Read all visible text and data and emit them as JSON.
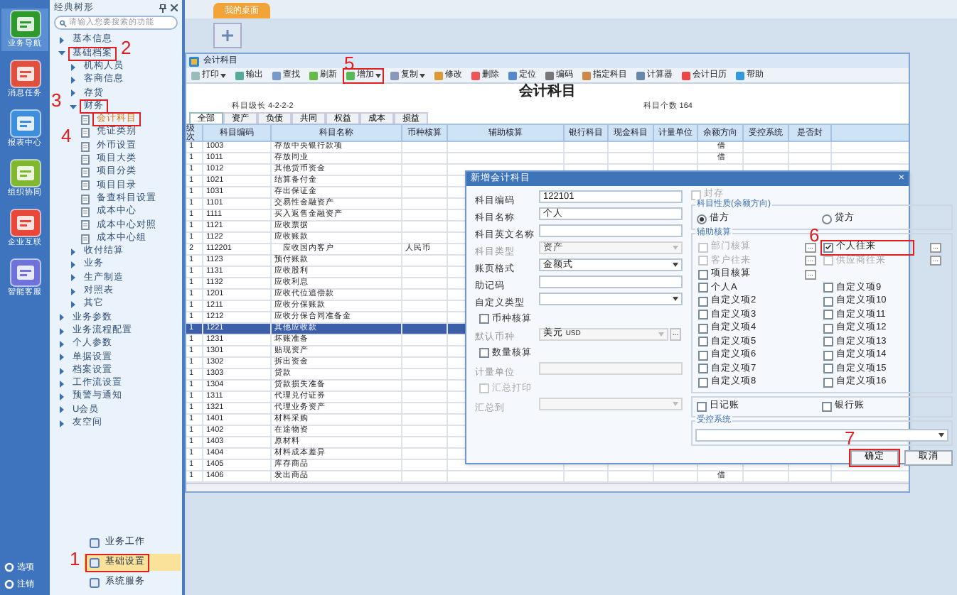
{
  "nav": {
    "items": [
      {
        "label": "业务导航",
        "selected": true
      },
      {
        "label": "消息任务",
        "selected": false
      },
      {
        "label": "报表中心",
        "selected": false
      },
      {
        "label": "组织协同",
        "selected": false
      },
      {
        "label": "企业互联",
        "selected": false
      },
      {
        "label": "智能客服",
        "selected": false
      }
    ],
    "bottom": [
      "选项",
      "注销"
    ]
  },
  "tree_panel": {
    "title": "经典树形",
    "search": {
      "placeholder": "请输入您要搜索的功能"
    },
    "tree": [
      {
        "label": "基本信息",
        "kind": "folder",
        "expanded": false
      },
      {
        "label": "基础档案",
        "kind": "folder",
        "expanded": true,
        "callout": "2",
        "children": [
          {
            "label": "机构人员",
            "kind": "folder",
            "expanded": false
          },
          {
            "label": "客商信息",
            "kind": "folder",
            "expanded": false
          },
          {
            "label": "存货",
            "kind": "folder",
            "expanded": false
          },
          {
            "label": "财务",
            "kind": "folder",
            "expanded": true,
            "callout": "3",
            "children": [
              {
                "label": "会计科目",
                "kind": "page",
                "selected": true,
                "callout": "4"
              },
              {
                "label": "凭证类别",
                "kind": "page",
                "selected": false
              },
              {
                "label": "外币设置",
                "kind": "page",
                "selected": false
              },
              {
                "label": "项目大类",
                "kind": "page",
                "selected": false
              },
              {
                "label": "项目分类",
                "kind": "page",
                "selected": false
              },
              {
                "label": "项目目录",
                "kind": "page",
                "selected": false
              },
              {
                "label": "备查科目设置",
                "kind": "page",
                "selected": false
              },
              {
                "label": "成本中心",
                "kind": "page",
                "selected": false
              },
              {
                "label": "成本中心对照",
                "kind": "page",
                "selected": false
              },
              {
                "label": "成本中心组",
                "kind": "page",
                "selected": false
              }
            ]
          },
          {
            "label": "收付结算",
            "kind": "folder",
            "expanded": false
          },
          {
            "label": "业务",
            "kind": "folder",
            "expanded": false
          },
          {
            "label": "生产制造",
            "kind": "folder",
            "expanded": false
          },
          {
            "label": "对照表",
            "kind": "folder",
            "expanded": false
          },
          {
            "label": "其它",
            "kind": "folder",
            "expanded": false
          }
        ]
      },
      {
        "label": "业务参数",
        "kind": "folder",
        "expanded": false
      },
      {
        "label": "业务流程配置",
        "kind": "folder",
        "expanded": false
      },
      {
        "label": "个人参数",
        "kind": "folder",
        "expanded": false
      },
      {
        "label": "单据设置",
        "kind": "folder",
        "expanded": false
      },
      {
        "label": "档案设置",
        "kind": "folder",
        "expanded": false
      },
      {
        "label": "工作流设置",
        "kind": "folder",
        "expanded": false
      },
      {
        "label": "预警与通知",
        "kind": "folder",
        "expanded": false
      },
      {
        "label": "U会员",
        "kind": "folder",
        "expanded": false
      },
      {
        "label": "友空间",
        "kind": "folder",
        "expanded": false
      }
    ],
    "sections": [
      {
        "label": "业务工作",
        "selected": false
      },
      {
        "label": "基础设置",
        "selected": true,
        "callout": "1"
      },
      {
        "label": "系统服务",
        "selected": false
      }
    ]
  },
  "tabs": [
    {
      "label": "我的桌面",
      "selected": true
    }
  ],
  "window": {
    "title": "会计科目",
    "toolbar": [
      {
        "label": "打印",
        "menu": true
      },
      {
        "label": "输出",
        "menu": false
      },
      {
        "label": "查找",
        "menu": false
      },
      {
        "label": "刷新",
        "menu": false
      },
      {
        "label": "增加",
        "menu": true,
        "callout": "5"
      },
      {
        "label": "复制",
        "menu": true
      },
      {
        "label": "修改",
        "menu": false
      },
      {
        "label": "删除",
        "menu": false
      },
      {
        "label": "定位",
        "menu": false
      },
      {
        "label": "编码",
        "menu": false
      },
      {
        "label": "指定科目",
        "menu": false
      },
      {
        "label": "计算器",
        "menu": false
      },
      {
        "label": "会计日历",
        "menu": false
      },
      {
        "label": "帮助",
        "menu": false
      }
    ],
    "heading": "会计科目",
    "level_info": "科目级长  4-2-2-2",
    "count_info": "科目个数  164",
    "tabs": [
      {
        "label": "全部",
        "selected": true
      },
      {
        "label": "资产",
        "selected": false
      },
      {
        "label": "负债",
        "selected": false
      },
      {
        "label": "共同",
        "selected": false
      },
      {
        "label": "权益",
        "selected": false
      },
      {
        "label": "成本",
        "selected": false
      },
      {
        "label": "损益",
        "selected": false
      }
    ],
    "columns": [
      "级次",
      "科目编码",
      "科目名称",
      "币种核算",
      "辅助核算",
      "银行科目",
      "现金科目",
      "计量单位",
      "余额方向",
      "受控系统",
      "是否封"
    ],
    "rows": [
      {
        "level": "1",
        "code": "1003",
        "name": "存放中央银行款项",
        "direction": "借",
        "selected": false
      },
      {
        "level": "1",
        "code": "1011",
        "name": "存放同业",
        "direction": "借",
        "selected": false
      },
      {
        "level": "1",
        "code": "1012",
        "name": "其他货币资金",
        "selected": false
      },
      {
        "level": "1",
        "code": "1021",
        "name": "结算备付金",
        "selected": false
      },
      {
        "level": "1",
        "code": "1031",
        "name": "存出保证金",
        "selected": false
      },
      {
        "level": "1",
        "code": "1101",
        "name": "交易性金融资产",
        "selected": false
      },
      {
        "level": "1",
        "code": "1111",
        "name": "买入返售金融资产",
        "selected": false
      },
      {
        "level": "1",
        "code": "1121",
        "name": "应收票据",
        "selected": false
      },
      {
        "level": "1",
        "code": "1122",
        "name": "应收账款",
        "selected": false
      },
      {
        "level": "2",
        "code": "112201",
        "name": "应收国内客户",
        "currency": "人民币",
        "selected": false
      },
      {
        "level": "1",
        "code": "1123",
        "name": "预付账款",
        "selected": false
      },
      {
        "level": "1",
        "code": "1131",
        "name": "应收股利",
        "selected": false
      },
      {
        "level": "1",
        "code": "1132",
        "name": "应收利息",
        "selected": false
      },
      {
        "level": "1",
        "code": "1201",
        "name": "应收代位追偿款",
        "selected": false
      },
      {
        "level": "1",
        "code": "1211",
        "name": "应收分保账款",
        "selected": false
      },
      {
        "level": "1",
        "code": "1212",
        "name": "应收分保合同准备金",
        "selected": false
      },
      {
        "level": "1",
        "code": "1221",
        "name": "其他应收款",
        "selected": true
      },
      {
        "level": "1",
        "code": "1231",
        "name": "坏账准备",
        "selected": false
      },
      {
        "level": "1",
        "code": "1301",
        "name": "贴现资产",
        "selected": false
      },
      {
        "level": "1",
        "code": "1302",
        "name": "拆出资金",
        "selected": false
      },
      {
        "level": "1",
        "code": "1303",
        "name": "贷款",
        "selected": false
      },
      {
        "level": "1",
        "code": "1304",
        "name": "贷款损失准备",
        "selected": false
      },
      {
        "level": "1",
        "code": "1311",
        "name": "代理兑付证券",
        "selected": false
      },
      {
        "level": "1",
        "code": "1321",
        "name": "代理业务资产",
        "selected": false
      },
      {
        "level": "1",
        "code": "1401",
        "name": "材料采购",
        "selected": false
      },
      {
        "level": "1",
        "code": "1402",
        "name": "在途物资",
        "selected": false
      },
      {
        "level": "1",
        "code": "1403",
        "name": "原材料",
        "selected": false
      },
      {
        "level": "1",
        "code": "1404",
        "name": "材料成本差异",
        "selected": false
      },
      {
        "level": "1",
        "code": "1405",
        "name": "库存商品",
        "selected": false
      },
      {
        "level": "1",
        "code": "1406",
        "name": "发出商品",
        "direction": "借",
        "selected": false
      }
    ]
  },
  "dialog": {
    "title": "新增会计科目",
    "close": "×",
    "fields": [
      {
        "kind": "text",
        "label": "科目编码",
        "value": "122101",
        "disabled": false
      },
      {
        "kind": "text",
        "label": "科目名称",
        "value": "个人",
        "disabled": false
      },
      {
        "kind": "text",
        "label": "科目英文名称",
        "disabled": false
      },
      {
        "kind": "select",
        "label": "科目类型",
        "value": "资产",
        "disabled": true
      },
      {
        "kind": "select",
        "label": "账页格式",
        "value": "金额式",
        "disabled": false
      },
      {
        "kind": "text",
        "label": "助记码",
        "disabled": false
      },
      {
        "kind": "select",
        "label": "自定义类型",
        "disabled": false
      },
      {
        "kind": "check",
        "label": "币种核算",
        "checked": false,
        "disabled": false
      },
      {
        "kind": "currency",
        "label": "默认币种",
        "value": "美元",
        "code": "USD",
        "more": "...",
        "disabled": true
      },
      {
        "kind": "check",
        "label": "数量核算",
        "checked": false,
        "disabled": false
      },
      {
        "kind": "text",
        "label": "计量单位",
        "disabled": true
      },
      {
        "kind": "check",
        "label": "汇总打印",
        "checked": false,
        "disabled": true
      },
      {
        "kind": "select",
        "label": "汇总到",
        "disabled": true
      }
    ],
    "sealed": {
      "label": "封存",
      "checked": false,
      "disabled": true
    },
    "direction": {
      "title": "科目性质(余额方向)",
      "options": [
        {
          "label": "借方",
          "selected": true
        },
        {
          "label": "贷方",
          "selected": false
        }
      ]
    },
    "aux": {
      "title": "辅助核算",
      "rows": [
        [
          {
            "label": "部门核算",
            "checked": false,
            "disabled": true,
            "more": "..."
          },
          {
            "label": "个人往来",
            "checked": true,
            "disabled": false,
            "more": "...",
            "callout": "6"
          }
        ],
        [
          {
            "label": "客户往来",
            "checked": false,
            "disabled": true,
            "more": "..."
          },
          {
            "label": "供应商往来",
            "checked": false,
            "disabled": true,
            "more": "..."
          }
        ],
        [
          {
            "label": "项目核算",
            "checked": false,
            "disabled": false,
            "more": "..."
          }
        ],
        [
          {
            "label": "个人A",
            "checked": false,
            "disabled": false
          },
          {
            "label": "自定义项9",
            "checked": false,
            "disabled": false
          }
        ],
        [
          {
            "label": "自定义项2",
            "checked": false,
            "disabled": false
          },
          {
            "label": "自定义项10",
            "checked": false,
            "disabled": false
          }
        ],
        [
          {
            "label": "自定义项3",
            "checked": false,
            "disabled": false
          },
          {
            "label": "自定义项11",
            "checked": false,
            "disabled": false
          }
        ],
        [
          {
            "label": "自定义项4",
            "checked": false,
            "disabled": false
          },
          {
            "label": "自定义项12",
            "checked": false,
            "disabled": false
          }
        ],
        [
          {
            "label": "自定义项5",
            "checked": false,
            "disabled": false
          },
          {
            "label": "自定义项13",
            "checked": false,
            "disabled": false
          }
        ],
        [
          {
            "label": "自定义项6",
            "checked": false,
            "disabled": false
          },
          {
            "label": "自定义项14",
            "checked": false,
            "disabled": false
          }
        ],
        [
          {
            "label": "自定义项7",
            "checked": false,
            "disabled": false
          },
          {
            "label": "自定义项15",
            "checked": false,
            "disabled": false
          }
        ],
        [
          {
            "label": "自定义项8",
            "checked": false,
            "disabled": false
          },
          {
            "label": "自定义项16",
            "checked": false,
            "disabled": false
          }
        ]
      ]
    },
    "ledgers": [
      {
        "label": "日记账",
        "checked": false
      },
      {
        "label": "银行账",
        "checked": false
      }
    ],
    "controlled": {
      "title": "受控系统"
    },
    "buttons": [
      {
        "label": "确定",
        "callout": "7"
      },
      {
        "label": "取消"
      }
    ]
  }
}
